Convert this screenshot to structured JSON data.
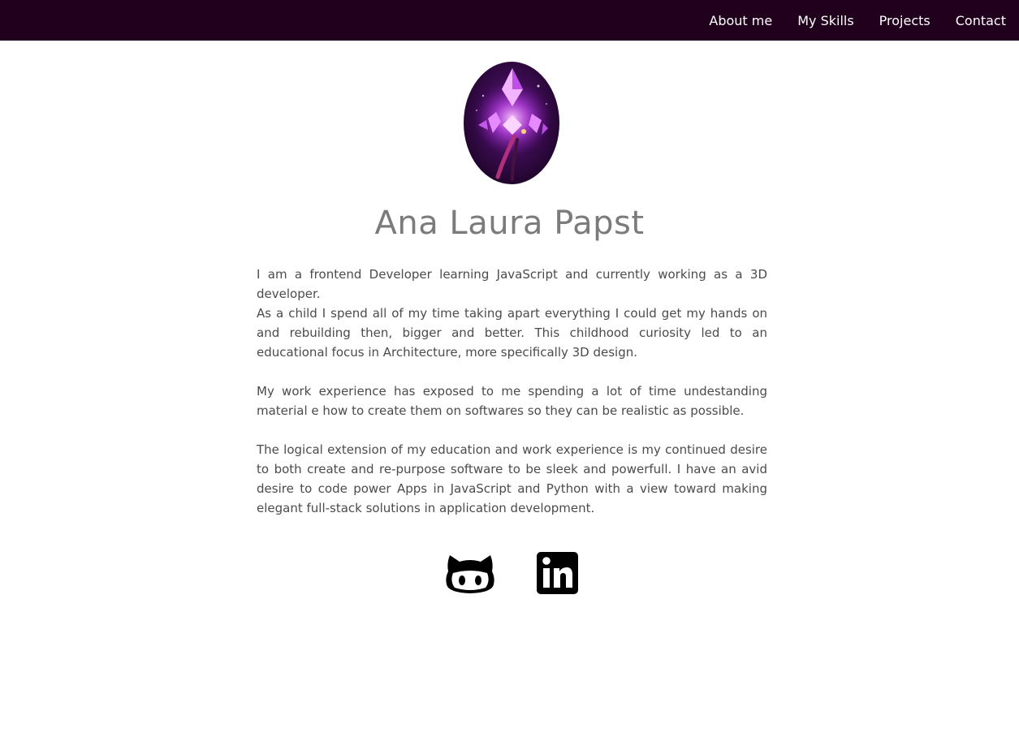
{
  "nav": {
    "links": [
      "About me",
      "My Skills",
      "Projects",
      "Contact"
    ],
    "background": "#21001e"
  },
  "profile": {
    "name": "Ana Laura Papst",
    "avatar_icon": "purple-crystal-avatar"
  },
  "bio": {
    "paragraph_1a": "I am a frontend Developer learning JavaScript and currently working as a 3D developer.",
    "paragraph_1b": "As a child I spend all of my time taking apart everything I could get my hands on and rebuilding then, bigger and better. This childhood curiosity led to an educational focus in Architecture, more specifically 3D design.",
    "paragraph_2": "My work experience has exposed to me spending a lot of time undestanding material e how to create them on softwares so they can be realistic as possible.",
    "paragraph_3": "The logical extension of my education and work experience is my continued desire to both create and re-purpose software to be sleek and powerfull. I have an avid desire to code power Apps in JavaScript and Python with a view toward making elegant full-stack solutions in application development."
  },
  "social": {
    "icons": [
      "github-icon",
      "linkedin-icon"
    ]
  }
}
